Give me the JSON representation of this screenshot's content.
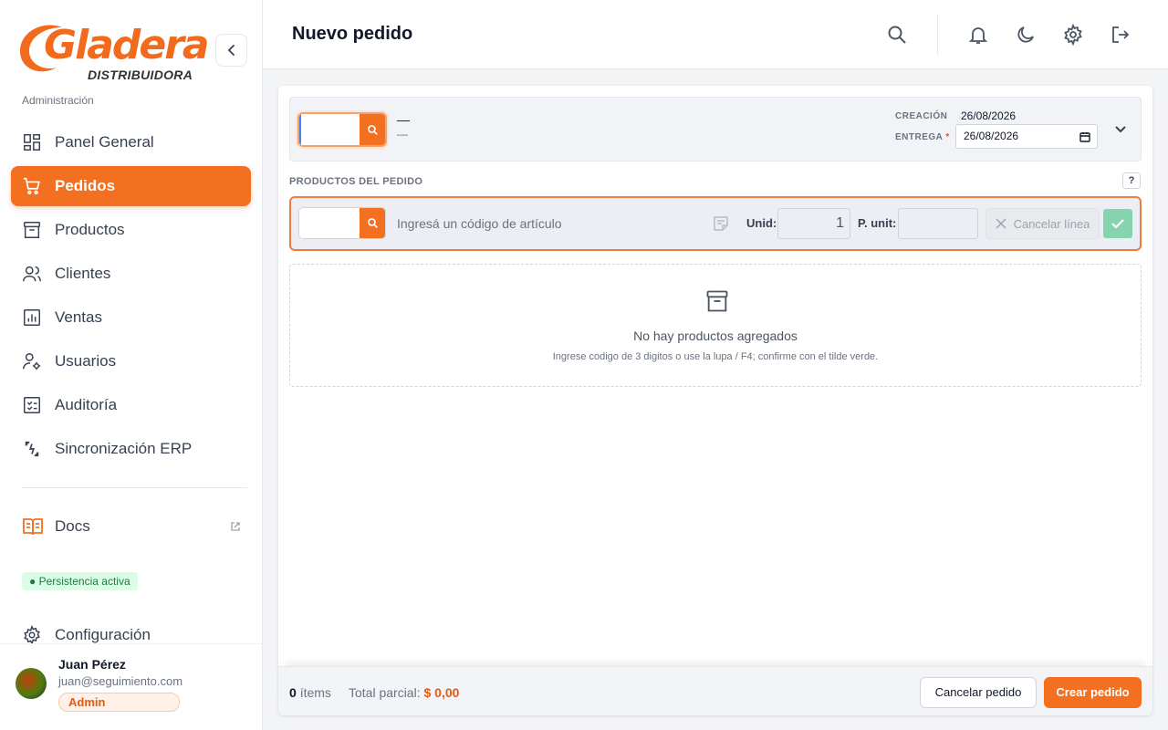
{
  "brand": {
    "name": "Gladera",
    "subtitle": "DISTRIBUIDORA",
    "accent": "#f37021"
  },
  "sidebar": {
    "section_label": "Administración",
    "items": [
      {
        "label": "Panel General",
        "icon": "dashboard-icon",
        "active": false
      },
      {
        "label": "Pedidos",
        "icon": "cart-icon",
        "active": true
      },
      {
        "label": "Productos",
        "icon": "archive-icon",
        "active": false
      },
      {
        "label": "Clientes",
        "icon": "users-icon",
        "active": false
      },
      {
        "label": "Ventas",
        "icon": "chart-icon",
        "active": false
      },
      {
        "label": "Usuarios",
        "icon": "user-gear-icon",
        "active": false
      },
      {
        "label": "Auditoría",
        "icon": "checklist-icon",
        "active": false
      },
      {
        "label": "Sincronización ERP",
        "icon": "sync-icon",
        "active": false
      }
    ],
    "docs_label": "Docs",
    "persistence_badge": "● Persistencia activa",
    "config_label": "Configuración",
    "user": {
      "name": "Juan Pérez",
      "email": "juan@seguimiento.com",
      "role": "Admin"
    }
  },
  "header": {
    "title": "Nuevo pedido"
  },
  "order": {
    "client_name": "—",
    "client_sub": "—",
    "creation_label": "CREACIÓN",
    "creation_date": "26/08/2026",
    "delivery_label": "ENTREGA",
    "delivery_required": "*",
    "delivery_date": "26/08/2026"
  },
  "products": {
    "section_label": "PRODUCTOS DEL PEDIDO",
    "help": "?",
    "line": {
      "description_placeholder": "Ingresá un código de artículo",
      "unid_label": "Unid:",
      "unid_value": "1",
      "punit_label": "P. unit:",
      "cancel_label": "Cancelar línea"
    },
    "empty_title": "No hay productos agregados",
    "empty_hint": "Ingrese codigo de 3 digitos o use la lupa / F4; confirme con el tilde verde."
  },
  "footer": {
    "items_count": "0",
    "items_label": "ítems",
    "total_label": "Total parcial:",
    "total_value": "$ 0,00",
    "cancel_button": "Cancelar pedido",
    "create_button": "Crear pedido"
  }
}
